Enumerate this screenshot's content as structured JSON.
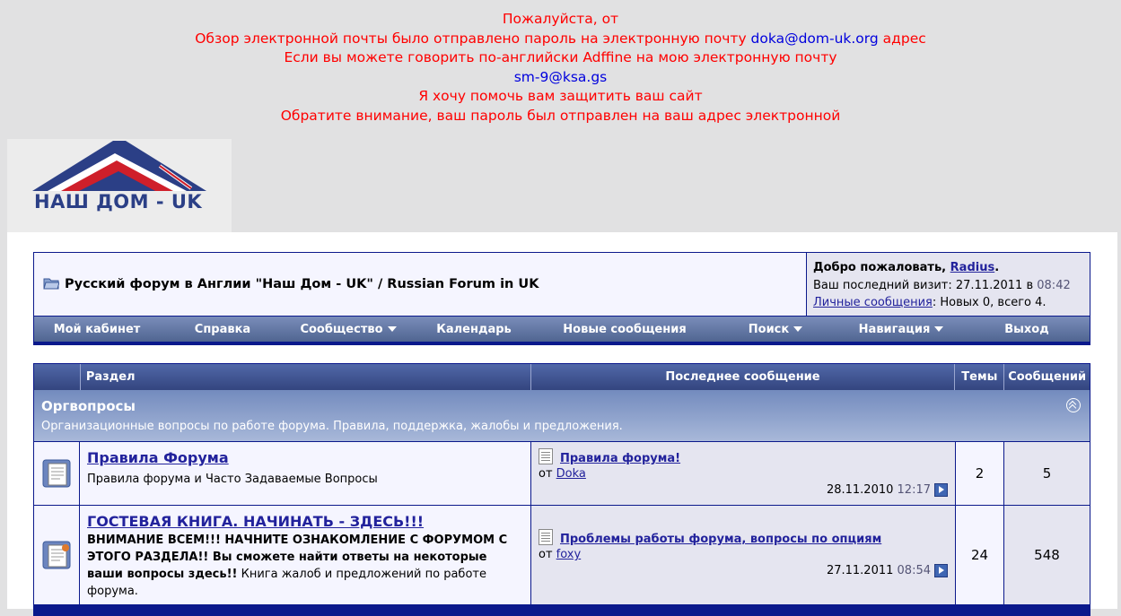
{
  "notice": {
    "line1": "Пожалуйста, от",
    "line2_pre": "Обзор электронной почты было отправлено пароль на электронную почту ",
    "line2_email": "doka@dom-uk.org",
    "line2_post": " адрес",
    "line3": "Если вы можете говорить по-английски Adffine на мою электронную почту",
    "line4_email": "sm-9@ksa.gs",
    "line5": "Я хочу помочь вам защитить ваш сайт",
    "line6": "Обратите внимание, ваш пароль был отправлен на ваш адрес электронной"
  },
  "logo": {
    "text": "НАШ ДОМ - UK",
    "colors": {
      "roof": "#2b3f86",
      "flag_red": "#cf1f2a",
      "text": "#2b3f86"
    }
  },
  "header": {
    "forum_title": "Русский форум в Англии \"Наш Дом - UK\" / Russian Forum in UK",
    "welcome_label": "Добро пожаловать, ",
    "username": "Radius",
    "last_visit_label": "Ваш последний визит: 27.11.2011 в ",
    "last_visit_time": "08:42",
    "pm_link": "Личные сообщения",
    "pm_status": ": Новых 0, всего 4."
  },
  "navbar": {
    "items": [
      {
        "label": "Мой кабинет",
        "dropdown": false
      },
      {
        "label": "Справка",
        "dropdown": false
      },
      {
        "label": "Сообщество",
        "dropdown": true
      },
      {
        "label": "Календарь",
        "dropdown": false
      },
      {
        "label": "Новые сообщения",
        "dropdown": false
      },
      {
        "label": "Поиск",
        "dropdown": true
      },
      {
        "label": "Навигация",
        "dropdown": true
      },
      {
        "label": "Выход",
        "dropdown": false
      }
    ]
  },
  "table": {
    "col_forum": "Раздел",
    "col_last": "Последнее сообщение",
    "col_threads": "Темы",
    "col_posts": "Сообщений"
  },
  "category": {
    "name": "Оргвопросы",
    "desc": "Организационные вопросы по работе форума. Правила, поддержка, жалобы и предложения."
  },
  "forums": [
    {
      "title": "Правила Форума",
      "desc": "Правила форума и Часто Задаваемые Вопросы",
      "last_title": "Правила форума!",
      "last_by_label": "от ",
      "last_by": "Doka",
      "last_date": "28.11.2010",
      "last_time": "12:17",
      "threads": "2",
      "posts": "5"
    },
    {
      "title": "ГОСТЕВАЯ КНИГА. НАЧИНАТЬ - ЗДЕСЬ!!!",
      "desc_bold": "ВНИМАНИЕ ВСЕМ!!! НАЧНИТЕ ОЗНАКОМЛЕНИЕ С ФОРУМОМ С ЭТОГО РАЗДЕЛА!! Вы сможете найти ответы на некоторые ваши вопросы здесь!!",
      "desc_rest": " Книга жалоб и предложений по работе форума.",
      "last_title": "Проблемы работы форума, вопросы по опциям",
      "last_by_label": "от ",
      "last_by": "foxy",
      "last_date": "27.11.2011",
      "last_time": "08:54",
      "threads": "24",
      "posts": "548"
    }
  ]
}
